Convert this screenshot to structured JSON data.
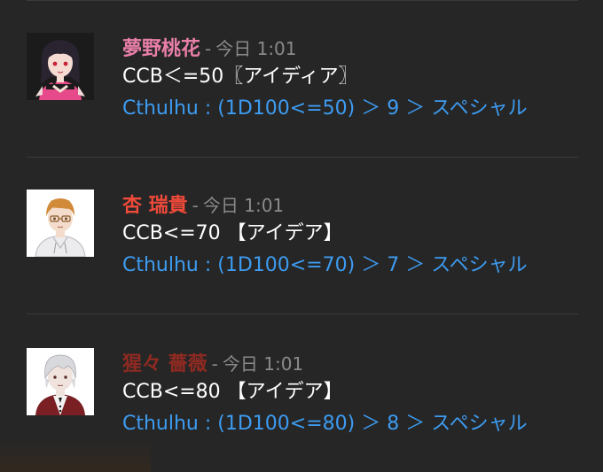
{
  "colors": {
    "background": "#262626",
    "divider": "#3a3a3a",
    "timestamp": "#8a8a8a",
    "message_text": "#ffffff",
    "dice_result": "#3d9bf0"
  },
  "messages": [
    {
      "author": "夢野桃花",
      "author_color": "#e87fa8",
      "separator": "-",
      "timestamp": "今日 1:01",
      "command": "CCB＜=50〖アイディア〗",
      "result": "Cthulhu : (1D100<=50) ＞ 9 ＞ スペシャル",
      "avatar_icon": "avatar-dark-hair-pink-dress-icon"
    },
    {
      "author": "杏 瑞貴",
      "author_color": "#f04a3a",
      "separator": "-",
      "timestamp": "今日 1:01",
      "command": "CCB<=70 【アイデア】",
      "result": "Cthulhu : (1D100<=70) ＞ 7 ＞ スペシャル",
      "avatar_icon": "avatar-glasses-white-hoodie-icon"
    },
    {
      "author": "猩々 薔薇",
      "author_color": "#8e2a22",
      "separator": "-",
      "timestamp": "今日 1:01",
      "command": "CCB<=80 【アイデア】",
      "result": "Cthulhu : (1D100<=80) ＞ 8 ＞ スペシャル",
      "avatar_icon": "avatar-silver-hair-red-vest-icon"
    }
  ]
}
